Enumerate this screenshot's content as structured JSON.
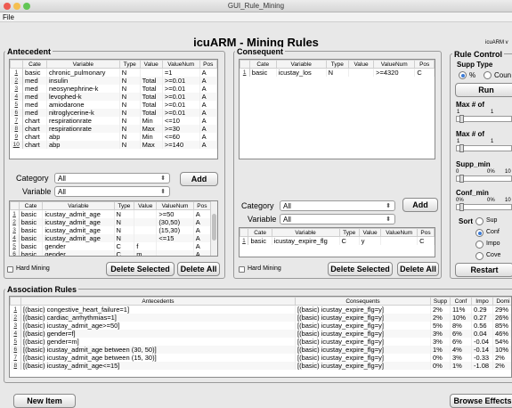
{
  "window": {
    "title": "GUI_Rule_Mining"
  },
  "menu": {
    "file": "File"
  },
  "app_title": "icuARM - Mining Rules",
  "app_version": "icuARM v",
  "antecedent": {
    "title": "Antecedent",
    "columns": [
      "Cate",
      "Variable",
      "Type",
      "Value",
      "ValueNum",
      "Pos"
    ],
    "rows": [
      [
        "1",
        "basic",
        "chronic_pulmonary",
        "N",
        "",
        "=1",
        "A"
      ],
      [
        "2",
        "med",
        "insulin",
        "N",
        "Total",
        ">=0.01",
        "A"
      ],
      [
        "3",
        "med",
        "neosynephrine-k",
        "N",
        "Total",
        ">=0.01",
        "A"
      ],
      [
        "4",
        "med",
        "levophed-k",
        "N",
        "Total",
        ">=0.01",
        "A"
      ],
      [
        "5",
        "med",
        "amiodarone",
        "N",
        "Total",
        ">=0.01",
        "A"
      ],
      [
        "6",
        "med",
        "nitroglycerine-k",
        "N",
        "Total",
        ">=0.01",
        "A"
      ],
      [
        "7",
        "chart",
        "respirationrate",
        "N",
        "Min",
        "<=10",
        "A"
      ],
      [
        "8",
        "chart",
        "respirationrate",
        "N",
        "Max",
        ">=30",
        "A"
      ],
      [
        "9",
        "chart",
        "abp",
        "N",
        "Min",
        "<=60",
        "A"
      ],
      [
        "10",
        "chart",
        "abp",
        "N",
        "Max",
        ">=140",
        "A"
      ]
    ],
    "category_label": "Category",
    "category_value": "All",
    "variable_label": "Variable",
    "variable_value": "All",
    "add_label": "Add",
    "list_columns": [
      "Cate",
      "Variable",
      "Type",
      "Value",
      "ValueNum",
      "Pos"
    ],
    "list_rows": [
      [
        "1",
        "basic",
        "icustay_admit_age",
        "N",
        "",
        ">=50",
        "A"
      ],
      [
        "2",
        "basic",
        "icustay_admit_age",
        "N",
        "",
        "(30,50)",
        "A"
      ],
      [
        "3",
        "basic",
        "icustay_admit_age",
        "N",
        "",
        "(15,30)",
        "A"
      ],
      [
        "4",
        "basic",
        "icustay_admit_age",
        "N",
        "",
        "<=15",
        "A"
      ],
      [
        "5",
        "basic",
        "gender",
        "C",
        "f",
        "",
        "A"
      ],
      [
        "6",
        "basic",
        "gender",
        "C",
        "m",
        "",
        "A"
      ]
    ],
    "hard_mining_label": "Hard Mining",
    "delete_selected_label": "Delete Selected",
    "delete_all_label": "Delete All"
  },
  "consequent": {
    "title": "Consequent",
    "columns": [
      "Cate",
      "Variable",
      "Type",
      "Value",
      "ValueNum",
      "Pos"
    ],
    "rows": [
      [
        "1",
        "basic",
        "icustay_los",
        "N",
        "",
        ">=4320",
        "C"
      ]
    ],
    "category_label": "Category",
    "category_value": "All",
    "variable_label": "Variable",
    "variable_value": "All",
    "add_label": "Add",
    "list_columns": [
      "Cate",
      "Variable",
      "Type",
      "Value",
      "ValueNum",
      "Pos"
    ],
    "list_rows": [
      [
        "1",
        "basic",
        "icustay_expire_flg",
        "C",
        "y",
        "",
        "C"
      ]
    ],
    "hard_mining_label": "Hard Mining",
    "delete_selected_label": "Delete Selected",
    "delete_all_label": "Delete All"
  },
  "rule_control": {
    "title": "Rule Control",
    "supp_type_label": "Supp Type",
    "supp_type_options": [
      "%",
      "Coun"
    ],
    "run_label": "Run",
    "max1_label": "Max # of",
    "max1_min": "1",
    "max1_max": "1",
    "max2_label": "Max # of",
    "max2_min": "1",
    "max2_max": "1",
    "supp_min_label": "Supp_min",
    "supp_min_ticks": [
      "0",
      "0%",
      "10"
    ],
    "conf_min_label": "Conf_min",
    "conf_min_ticks": [
      "0%",
      "0%",
      "10"
    ],
    "sort_label": "Sort",
    "sort_options": [
      "Sup",
      "Conf",
      "Impo",
      "Cove"
    ],
    "sort_selected": "Conf",
    "restart_label": "Restart"
  },
  "rules": {
    "title": "Association Rules",
    "columns": [
      "Antecedents",
      "Consequents",
      "Supp",
      "Conf",
      "Impo",
      "Domi"
    ],
    "rows": [
      [
        "1",
        "[(basic) congestive_heart_failure=1]",
        "[(basic) icustay_expire_flg=y]",
        "2%",
        "11%",
        "0.29",
        "29%"
      ],
      [
        "2",
        "[(basic) cardiac_arrhythmias=1]",
        "[(basic) icustay_expire_flg=y]",
        "2%",
        "10%",
        "0.27",
        "26%"
      ],
      [
        "3",
        "[(basic) icustay_admit_age>=50]",
        "[(basic) icustay_expire_flg=y]",
        "5%",
        "8%",
        "0.56",
        "85%"
      ],
      [
        "4",
        "[(basic) gender=f]",
        "[(basic) icustay_expire_flg=y]",
        "3%",
        "6%",
        "0.04",
        "46%"
      ],
      [
        "5",
        "[(basic) gender=m]",
        "[(basic) icustay_expire_flg=y]",
        "3%",
        "6%",
        "-0.04",
        "54%"
      ],
      [
        "6",
        "[(basic) icustay_admit_age between (30, 50)]",
        "[(basic) icustay_expire_flg=y]",
        "1%",
        "4%",
        "-0.14",
        "10%"
      ],
      [
        "7",
        "[(basic) icustay_admit_age between (15, 30)]",
        "[(basic) icustay_expire_flg=y]",
        "0%",
        "3%",
        "-0.33",
        "2%"
      ],
      [
        "8",
        "[(basic) icustay_admit_age<=15]",
        "[(basic) icustay_expire_flg=y]",
        "0%",
        "1%",
        "-1.08",
        "2%"
      ]
    ],
    "new_item_label": "New Item",
    "browse_effects_label": "Browse Effects"
  },
  "colors": {
    "close": "#ee5b52",
    "minimize": "#f5bf4f",
    "maximize": "#62c655",
    "radio_on": "#3b7bd6"
  }
}
